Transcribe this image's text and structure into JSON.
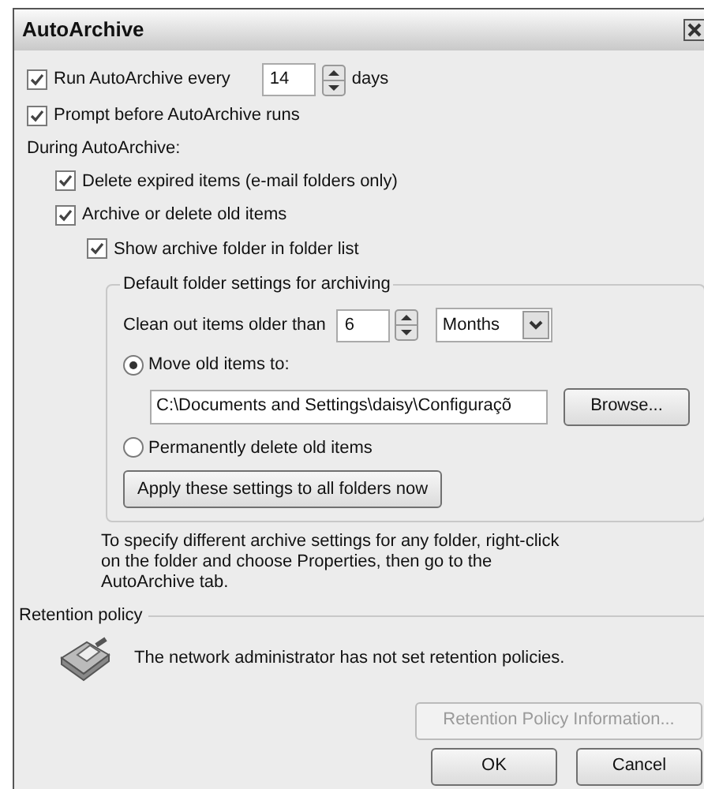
{
  "window": {
    "title": "AutoArchive"
  },
  "run_every": {
    "label": "Run AutoArchive every",
    "checked": true,
    "value": "14",
    "unit": "days"
  },
  "prompt": {
    "label": "Prompt before AutoArchive runs",
    "checked": true
  },
  "during": {
    "label": "During AutoArchive:",
    "options": [
      {
        "label": "Delete expired items (e-mail folders only)",
        "checked": true
      },
      {
        "label": "Archive or delete old items",
        "checked": true,
        "children": [
          {
            "label": "Show archive folder in folder list",
            "checked": true
          }
        ]
      }
    ]
  },
  "default_settings": {
    "title": "Default folder settings for archiving",
    "clean_out": {
      "label": "Clean out items older than",
      "value": "6",
      "unit": "Months"
    },
    "actions": [
      {
        "label": "Move old items to:",
        "selected": true,
        "path": "C:\\Documents and Settings\\daisy\\Configuraçõ"
      },
      {
        "label": "Permanently delete old items",
        "selected": false
      }
    ],
    "browse_button": "Browse...",
    "apply_button": "Apply these settings to all folders now"
  },
  "note": "To specify different archive settings for any folder, right-click on the folder and choose Properties, then go to the AutoArchive tab.",
  "retention": {
    "title": "Retention policy",
    "message": "The network administrator has not set retention policies.",
    "info_button": {
      "label": "Retention Policy Information...",
      "disabled": true
    }
  },
  "buttons": [
    "OK",
    "Cancel"
  ]
}
